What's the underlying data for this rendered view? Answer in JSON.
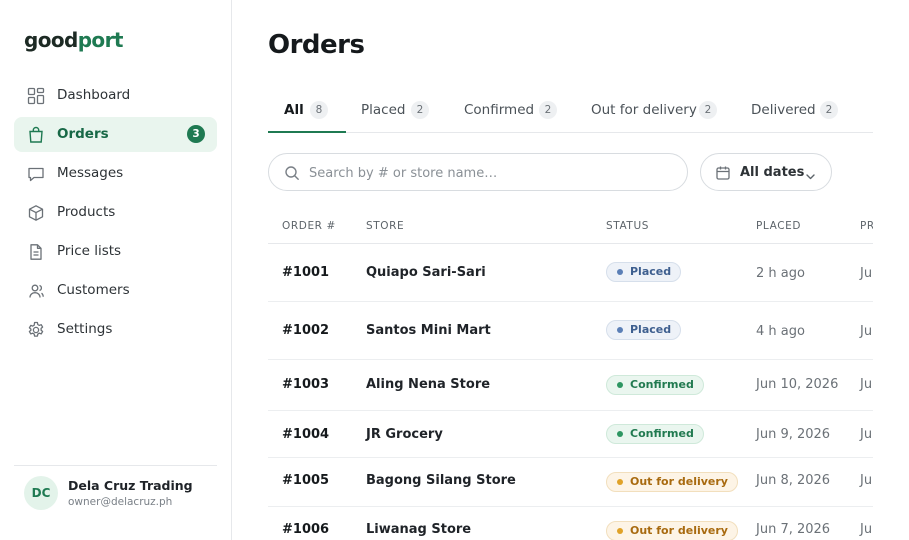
{
  "brand": {
    "part1": "good",
    "part2": "port"
  },
  "sidebar": {
    "items": [
      {
        "label": "Dashboard",
        "icon": "dashboard-icon"
      },
      {
        "label": "Orders",
        "icon": "shopping-bag-icon",
        "badge": "3",
        "active": true
      },
      {
        "label": "Messages",
        "icon": "message-icon"
      },
      {
        "label": "Products",
        "icon": "box-icon"
      },
      {
        "label": "Price lists",
        "icon": "document-icon"
      },
      {
        "label": "Customers",
        "icon": "users-icon"
      },
      {
        "label": "Settings",
        "icon": "gear-icon"
      }
    ],
    "account": {
      "initials": "DC",
      "name": "Dela Cruz Trading",
      "email": "owner@delacruz.ph"
    }
  },
  "main": {
    "title": "Orders",
    "tabs": [
      {
        "label": "All",
        "count": "8",
        "active": true
      },
      {
        "label": "Placed",
        "count": "2"
      },
      {
        "label": "Confirmed",
        "count": "2"
      },
      {
        "label": "Out for delivery",
        "count": "2"
      },
      {
        "label": "Delivered",
        "count": "2"
      }
    ],
    "search": {
      "placeholder": "Search by # or store name…",
      "value": ""
    },
    "date_filter": {
      "label": "All dates"
    },
    "table": {
      "columns": [
        "ORDER #",
        "STORE",
        "STATUS",
        "PLACED",
        "PR"
      ],
      "rows": [
        {
          "order": "#1001",
          "store": "Quiapo Sari-Sari",
          "status": "Placed",
          "placed": "2 h ago",
          "pr": "Ju"
        },
        {
          "order": "#1002",
          "store": "Santos Mini Mart",
          "status": "Placed",
          "placed": "4 h ago",
          "pr": "Ju"
        },
        {
          "order": "#1003",
          "store": "Aling Nena Store",
          "status": "Confirmed",
          "placed": "Jun 10, 2026",
          "pr": "Ju"
        },
        {
          "order": "#1004",
          "store": "JR Grocery",
          "status": "Confirmed",
          "placed": "Jun 9, 2026",
          "pr": "Ju"
        },
        {
          "order": "#1005",
          "store": "Bagong Silang Store",
          "status": "Out for delivery",
          "placed": "Jun 8, 2026",
          "pr": "Ju"
        },
        {
          "order": "#1006",
          "store": "Liwanag Store",
          "status": "Out for delivery",
          "placed": "Jun 7, 2026",
          "pr": "Ju"
        }
      ]
    }
  },
  "colors": {
    "accent": "#1f7a52",
    "accent_bg": "#e9f5ee",
    "placed": "#5b7fb6",
    "confirmed": "#2e9662",
    "out_for_delivery": "#e0a228"
  }
}
